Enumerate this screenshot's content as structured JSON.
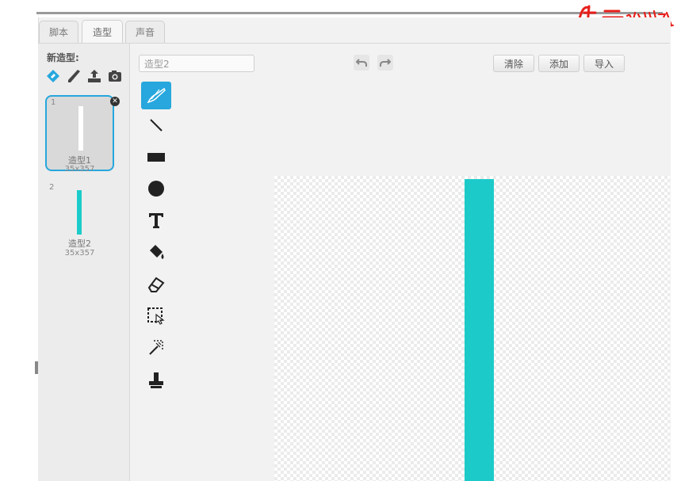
{
  "logo": {
    "text": "速云少儿编程"
  },
  "tabs": [
    {
      "label": "脚本",
      "active": false
    },
    {
      "label": "造型",
      "active": true
    },
    {
      "label": "声音",
      "active": false
    }
  ],
  "new_costume": {
    "label": "新造型:",
    "icons": [
      "paint-brush-icon",
      "pencil-icon",
      "upload-icon",
      "camera-icon"
    ]
  },
  "costumes": [
    {
      "index": "1",
      "name": "造型1",
      "size": "35x357",
      "selected": true,
      "color": "#ffffff"
    },
    {
      "index": "2",
      "name": "造型2",
      "size": "35x357",
      "selected": false,
      "color": "#1ccbc9"
    }
  ],
  "editor": {
    "name_value": "造型2",
    "buttons": {
      "clear": "清除",
      "add": "添加",
      "import": "导入"
    }
  },
  "tools": [
    "brush",
    "line",
    "rectangle",
    "ellipse",
    "text",
    "fill",
    "eraser",
    "select",
    "reshape",
    "stamp"
  ],
  "active_tool": "brush",
  "colors": {
    "accent": "#27a7dd",
    "costume_teal": "#1ccbc9",
    "logo_red": "#e8201c"
  }
}
